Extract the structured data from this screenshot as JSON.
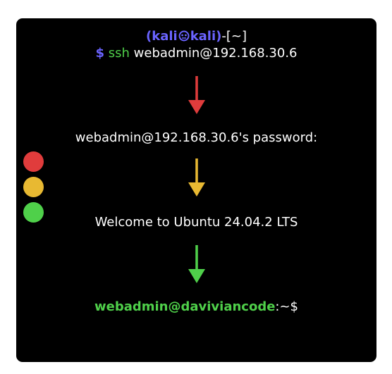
{
  "terminal": {
    "prompt": {
      "open": "(kali",
      "host": "kali)",
      "dir": "-[~]"
    },
    "command": {
      "dollar": "$",
      "keyword": "ssh",
      "target": "webadmin@192.168.30.6"
    },
    "password_prompt": "webadmin@192.168.30.6's password:",
    "welcome": "Welcome to Ubuntu 24.04.2 LTS",
    "final_prompt": {
      "user_host": "webadmin@daviviancode",
      "path": ":~$"
    }
  },
  "colors": {
    "background": "#000000",
    "kali_blue": "#6a63ff",
    "arrow_red": "#e03c3c",
    "arrow_yellow": "#e8b932",
    "arrow_green": "#4fd04a",
    "text": "#ffffff"
  },
  "icons": {
    "kali_symbol": "kali-skull-icon",
    "traffic_lights": [
      "red-dot",
      "yellow-dot",
      "green-dot"
    ]
  }
}
